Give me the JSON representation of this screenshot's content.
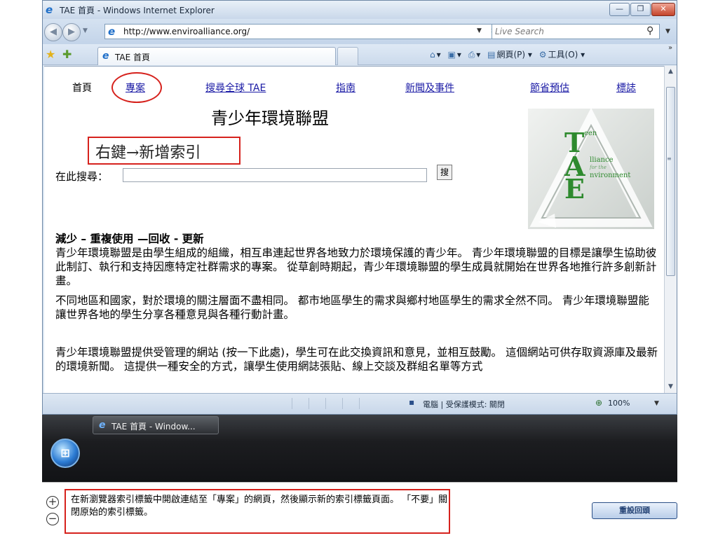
{
  "window": {
    "title": "TAE 首頁 - Windows Internet Explorer",
    "controls": {
      "minimize": "—",
      "maximize": "❐",
      "close": "✕"
    }
  },
  "address_bar": {
    "url": "http://www.enviroalliance.org/",
    "search_placeholder": "Live Search"
  },
  "tabs": {
    "active_label": "TAE 首頁"
  },
  "command_bar": {
    "page_menu": "網頁(P)",
    "tools_menu": "工具(O)"
  },
  "site": {
    "nav": {
      "home": "首頁",
      "projects": "專案",
      "search_all": "搜尋全球 TAE",
      "guide": "指南",
      "news": "新聞及事件",
      "energy": "節省預估",
      "logo": "標誌"
    },
    "title": "青少年環境聯盟",
    "callout": "右鍵→新增索引",
    "search_label": "在此搜尋：",
    "search_button": "搜",
    "heading": "減少 – 重複使用 —回收 - 更新",
    "p1": "青少年環境聯盟是由學生組成的組織，相互串連起世界各地致力於環境保護的青少年。 青少年環境聯盟的目標是讓學生協助彼此制訂、執行和支持因應特定社群需求的專案。 從草創時期起，青少年環境聯盟的學生成員就開始在世界各地推行許多創新計畫。",
    "p2": "不同地區和國家，對於環境的關注層面不盡相同。 都市地區學生的需求與鄉村地區學生的需求全然不同。 青少年環境聯盟能讓世界各地的學生分享各種意見與各種行動計畫。",
    "p3": "青少年環境聯盟提供受管理的網站 (按一下此處)，學生可在此交換資訊和意見，並相互鼓勵。 這個網站可供存取資源庫及最新的環境新聞。 這提供一種安全的方式，讓學生使用網誌張貼、線上交談及群組名單等方式",
    "logo": {
      "letter_t": "T",
      "text_t": "een",
      "letter_a": "A",
      "text_a": "lliance",
      "text_for": "for the",
      "letter_e": "E",
      "text_e": "nvironment"
    }
  },
  "status_bar": {
    "zone": "電腦 | 受保護模式: 關閉",
    "zoom": "100%"
  },
  "taskbar": {
    "task_label": "TAE 首頁 - Window..."
  },
  "tutorial": {
    "instruction": "在新瀏覽器索引標籤中開啟連結至「專案」的網頁，然後顯示新的索引標籤頁面。 「不要」關閉原始的索引標籤。",
    "record_button": "重設回頭"
  },
  "colors": {
    "annotation_red": "#d6221d",
    "link_blue": "#1a1aa5",
    "logo_green": "#2e8a2e"
  }
}
